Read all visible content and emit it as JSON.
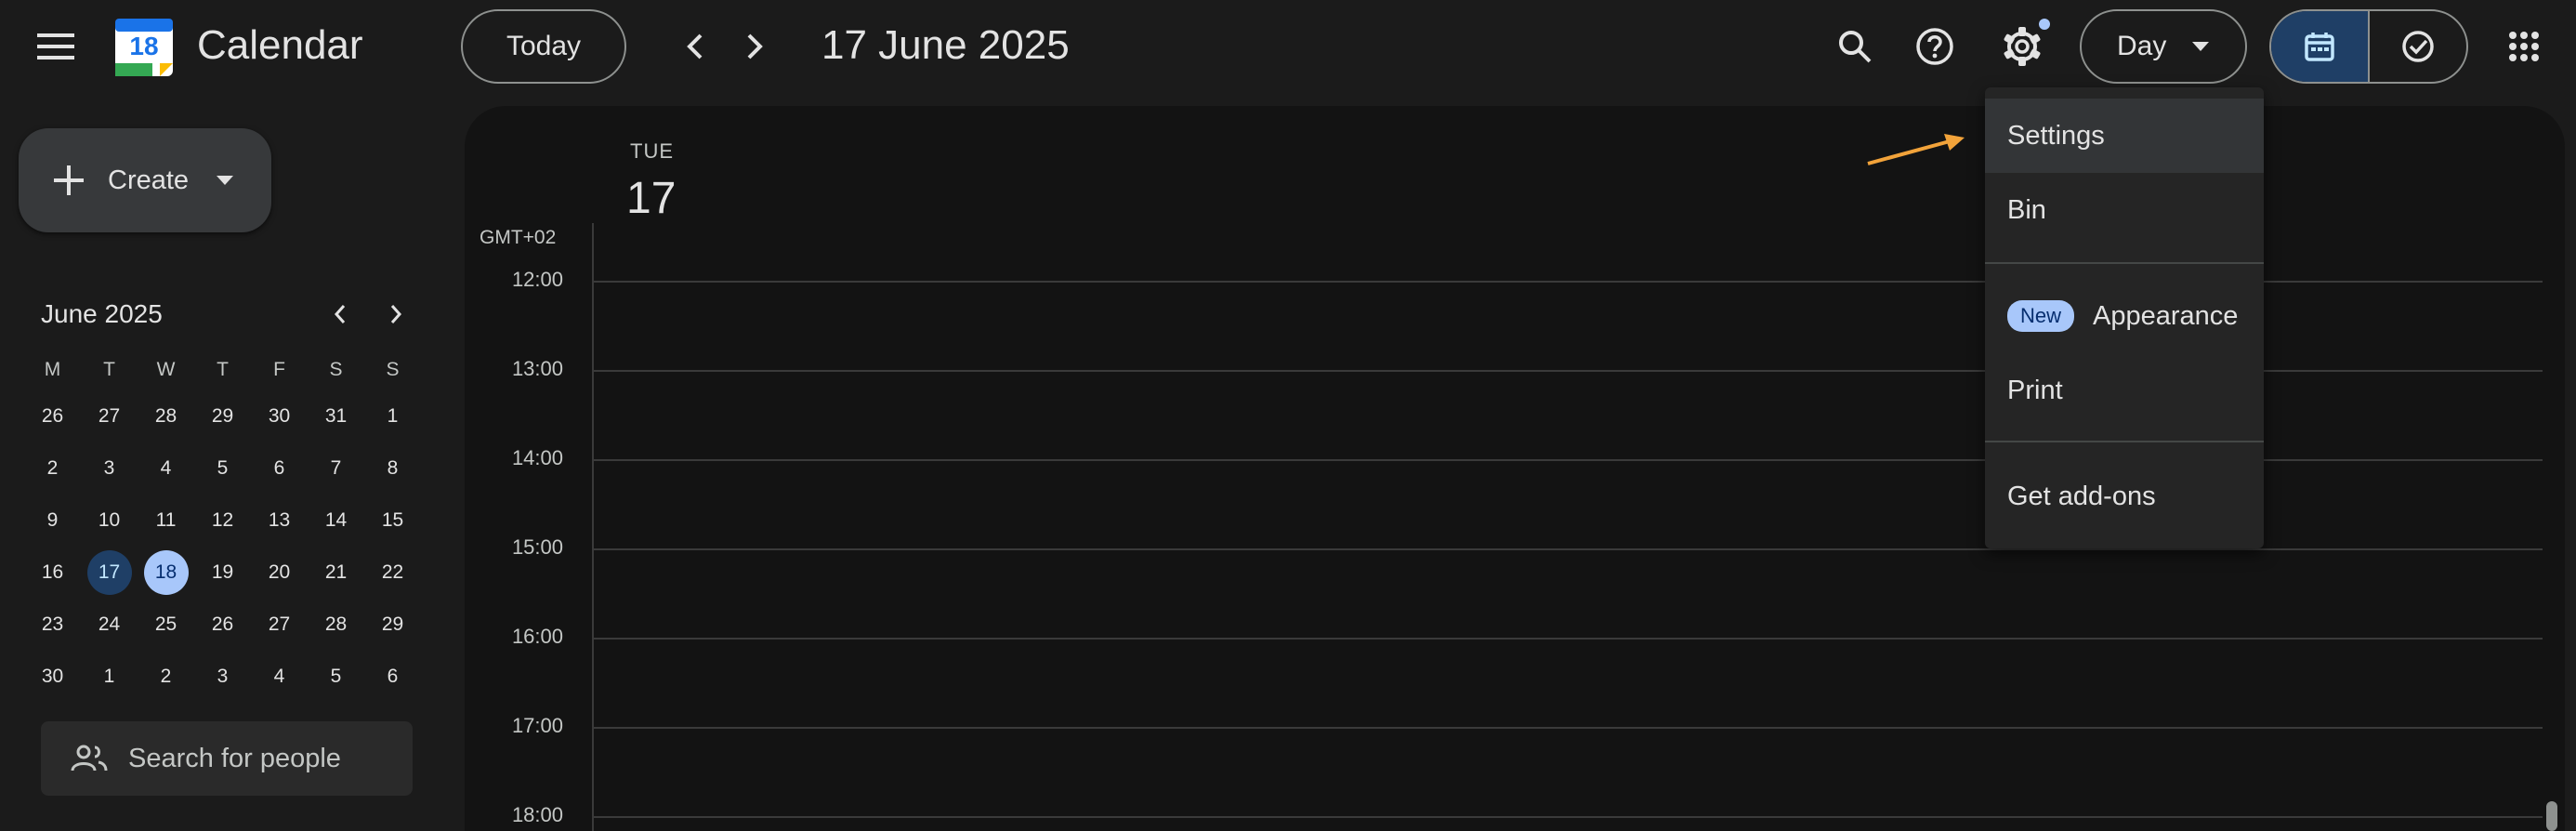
{
  "app": {
    "title": "Calendar",
    "logo_day": "18"
  },
  "toolbar": {
    "today_label": "Today",
    "date_title": "17 June 2025",
    "view_label": "Day"
  },
  "sidebar": {
    "create_label": "Create",
    "mini_calendar": {
      "month_label": "June 2025",
      "weekdays": [
        "M",
        "T",
        "W",
        "T",
        "F",
        "S",
        "S"
      ],
      "weeks": [
        [
          "26",
          "27",
          "28",
          "29",
          "30",
          "31",
          "1"
        ],
        [
          "2",
          "3",
          "4",
          "5",
          "6",
          "7",
          "8"
        ],
        [
          "9",
          "10",
          "11",
          "12",
          "13",
          "14",
          "15"
        ],
        [
          "16",
          "17",
          "18",
          "19",
          "20",
          "21",
          "22"
        ],
        [
          "23",
          "24",
          "25",
          "26",
          "27",
          "28",
          "29"
        ],
        [
          "30",
          "1",
          "2",
          "3",
          "4",
          "5",
          "6"
        ]
      ],
      "today": "17",
      "selected": "18"
    },
    "search_people_placeholder": "Search for people"
  },
  "day_view": {
    "weekday": "TUE",
    "day_number": "17",
    "timezone": "GMT+02",
    "hours": [
      "12:00",
      "13:00",
      "14:00",
      "15:00",
      "16:00",
      "17:00",
      "18:00"
    ]
  },
  "settings_menu": {
    "items": {
      "settings": "Settings",
      "bin": "Bin",
      "new_badge": "New",
      "appearance": "Appearance",
      "print": "Print",
      "addons": "Get add-ons"
    }
  },
  "colors": {
    "background": "#1b1b1b",
    "panel": "#131313",
    "accent_blue": "#a8c7fa",
    "today_circle": "#1f3f66",
    "arrow_orange": "#f2a33a",
    "notification_dot": "#a8c7fa"
  }
}
